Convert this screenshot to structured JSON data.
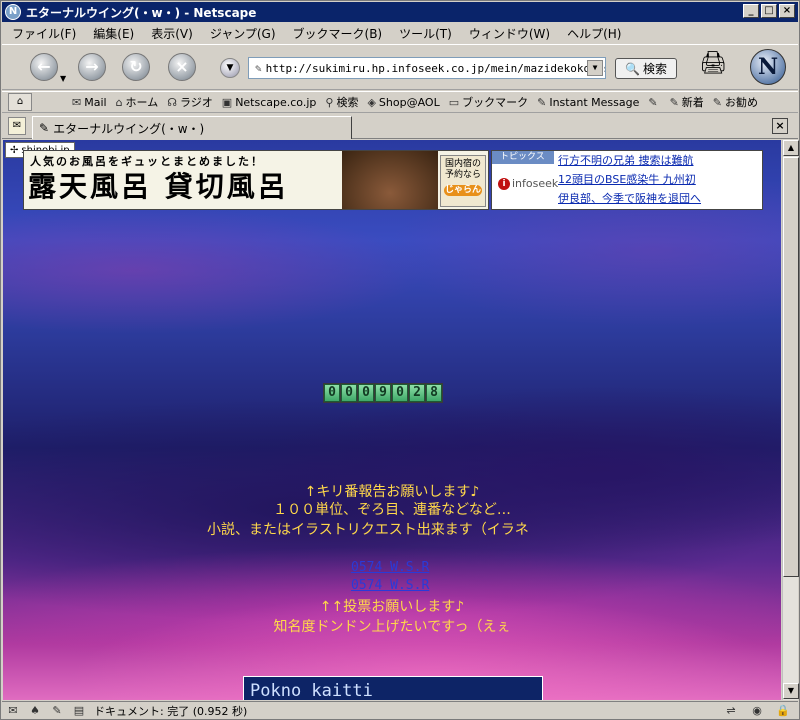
{
  "window": {
    "title": "エターナルウイング(・w・) - Netscape",
    "app_icon": "N"
  },
  "menu": [
    "ファイル(F)",
    "編集(E)",
    "表示(V)",
    "ジャンプ(G)",
    "ブックマーク(B)",
    "ツール(T)",
    "ウィンドウ(W)",
    "ヘルプ(H)"
  ],
  "nav": {
    "url": "http://sukimiru.hp.infoseek.co.jp/mein/mazidekokodesu.html",
    "search_label": "検索",
    "logo": "N"
  },
  "personal_toolbar": [
    "Mail",
    "ホーム",
    "ラジオ",
    "Netscape.co.jp",
    "検索",
    "Shop@AOL",
    "ブックマーク",
    "Instant Message",
    "",
    "新着",
    "お勧め"
  ],
  "tab": {
    "label": "エターナルウイング(・w・)"
  },
  "page": {
    "shinobi": "shinobi.jp",
    "ad_left": {
      "tagline": "人気のお風呂をギュッとまとめました！",
      "headline": "露天風呂 貸切風呂",
      "stamp_line1": "国内宿の",
      "stamp_line2": "予約なら",
      "stamp_brand": "じゃらん"
    },
    "ad_right": {
      "topics_label": "トピックス",
      "brand": "infoseek",
      "news": [
        "行方不明の兄弟 捜索は難航",
        "12頭目のBSE感染牛 九州初",
        "伊良部、今季で阪神を退団へ"
      ]
    },
    "counter": [
      "0",
      "0",
      "0",
      "9",
      "0",
      "2",
      "8"
    ],
    "lines": {
      "kiri": "↑キリ番報告お願いします♪",
      "units": "１００単位、ぞろ目、連番などなど…",
      "request": "小説、またはイラストリクエスト出来ます（イラネ",
      "vote_link1": "0574 W.S.R",
      "vote_link2": "0574 W.S.R",
      "vote": "↑↑投票お願いします♪",
      "fame": "知名度ドンドン上げたいですっ（えぇ"
    },
    "banner2_text": "Pokno kaitti"
  },
  "status": {
    "text": "ドキュメント: 完了 (0.952 秒)"
  }
}
